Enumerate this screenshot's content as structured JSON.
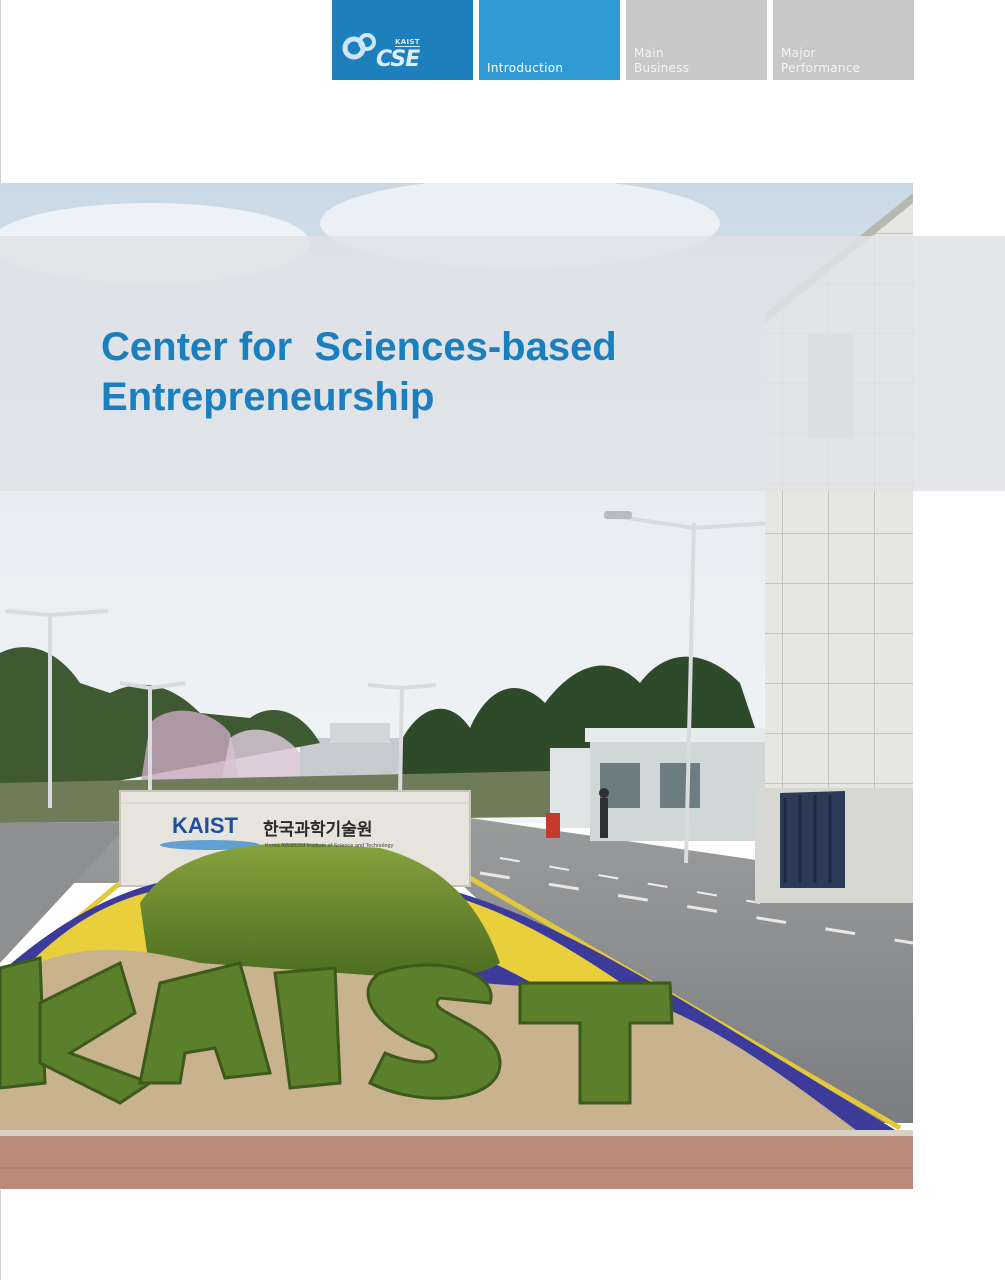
{
  "nav": {
    "logo": {
      "top_text": "KAIST",
      "main_text": "CSE",
      "icon": "kaist-swirl-icon"
    },
    "tabs": [
      {
        "label": "Introduction",
        "state": "active"
      },
      {
        "label_line1": "Main",
        "label_line2": "Business",
        "state": "inactive"
      },
      {
        "label_line1": "Major",
        "label_line2": "Performance",
        "state": "inactive"
      }
    ]
  },
  "hero": {
    "title_line1": "Center for  Sciences-based",
    "title_line2": "Entrepreneurship",
    "sign": {
      "logo_text": "KAIST",
      "korean_name": "한국과학기술원",
      "english_name": "Korea Advanced Institute of Science and Technology"
    }
  },
  "colors": {
    "title": "#1a7fbf",
    "tab_logo": "#1e7fbd",
    "tab_active": "#2f9ad4",
    "tab_inactive": "#c8c8c8",
    "band": "#e0e2e5"
  }
}
